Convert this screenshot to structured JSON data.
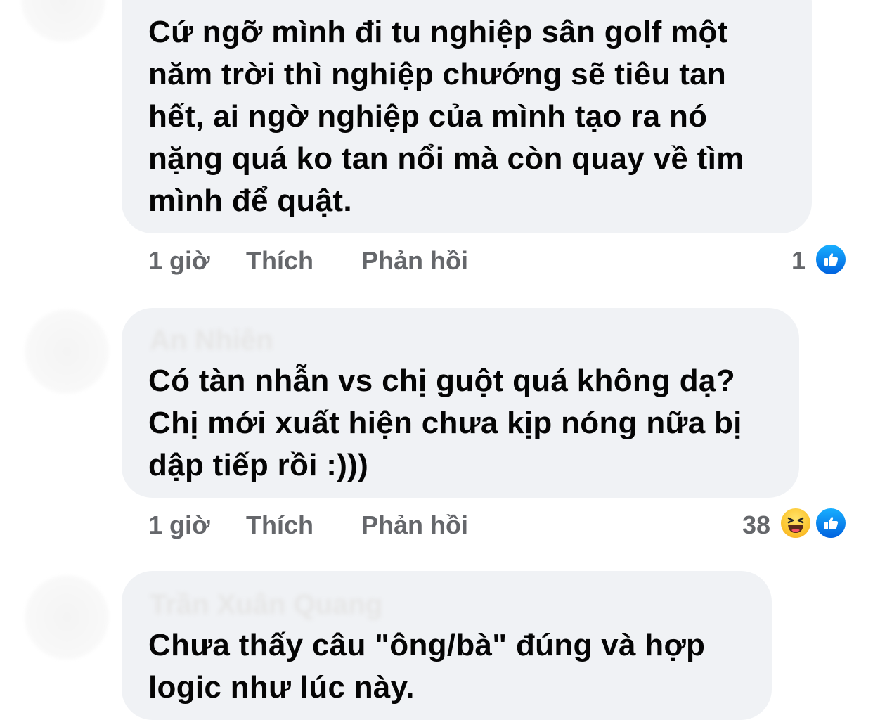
{
  "comments": [
    {
      "author": "",
      "lines": [
        "Cứ ngỡ mình đi tu nghiệp sân golf một",
        "năm trời thì nghiệp chướng sẽ tiêu tan",
        "hết, ai ngờ nghiệp của mình tạo ra nó",
        "nặng quá ko tan nổi mà còn quay về tìm",
        "mình  để quật."
      ],
      "time": "1 giờ",
      "like_label": "Thích",
      "reply_label": "Phản hồi",
      "reaction_count": "1",
      "reactions": [
        "like-icon"
      ]
    },
    {
      "author": "An Nhiên",
      "lines": [
        "Có tàn nhẫn vs chị guột quá không dạ?",
        "Chị mới xuất hiện chưa kịp nóng nữa bị",
        "dập tiếp rồi :)))"
      ],
      "time": "1 giờ",
      "like_label": "Thích",
      "reply_label": "Phản hồi",
      "reaction_count": "38",
      "reactions": [
        "haha-icon",
        "like-icon"
      ]
    },
    {
      "author": "Trần Xuân Quang",
      "lines": [
        "Chưa thấy câu \"ông/bà\" đúng và hợp",
        "logic như lúc này."
      ]
    }
  ],
  "colors": {
    "bubble": "#f0f2f5",
    "text": "#050505",
    "meta": "#65676b",
    "like_blue": "#1877f2",
    "haha_yellow": "#fcc52f"
  }
}
